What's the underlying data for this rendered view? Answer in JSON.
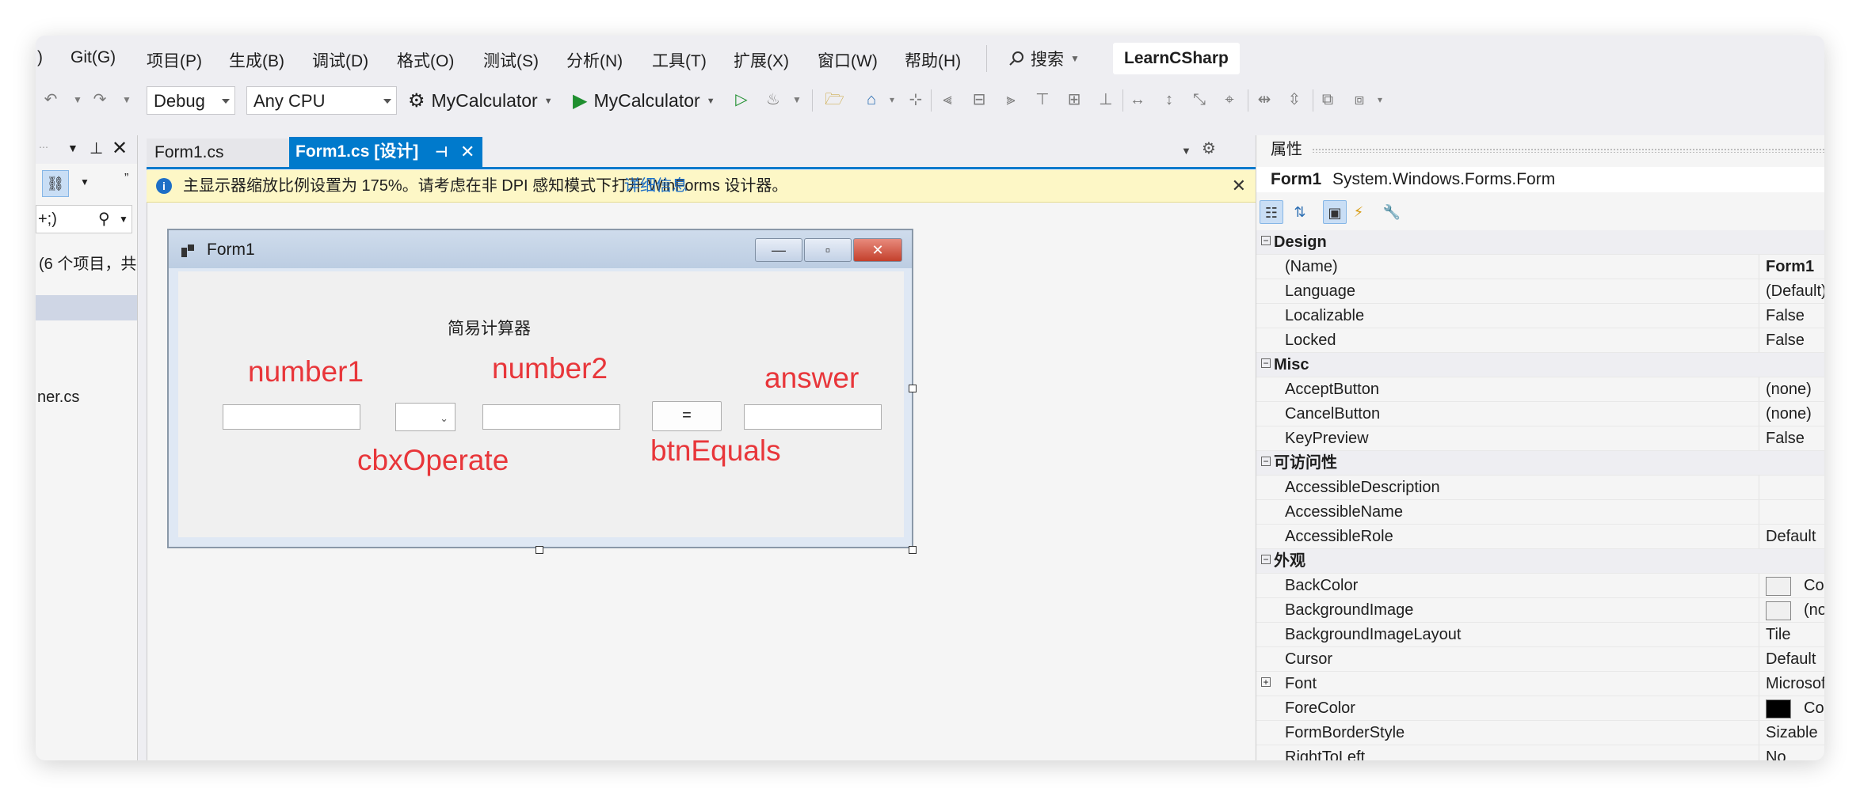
{
  "menu": {
    "items": [
      ")",
      "Git(G)",
      "项目(P)",
      "生成(B)",
      "调试(D)",
      "格式(O)",
      "测试(S)",
      "分析(N)",
      "工具(T)",
      "扩展(X)",
      "窗口(W)",
      "帮助(H)"
    ],
    "search_label": "搜索",
    "solution_name": "LearnCSharp"
  },
  "toolbar": {
    "config": "Debug",
    "platform": "Any CPU",
    "startup_project": "MyCalculator",
    "run_target": "MyCalculator"
  },
  "left_panel": {
    "search_text": "+;)",
    "summary_text": "(6 个项目，共",
    "file_fragment": "ner.cs"
  },
  "tabs": [
    {
      "label": "Form1.cs",
      "active": false
    },
    {
      "label": "Form1.cs [设计]",
      "active": true
    }
  ],
  "infobar": {
    "message": "主显示器缩放比例设置为 175%。请考虑在非 DPI 感知模式下打开 WinForms 设计器。",
    "link": "详细信息"
  },
  "form": {
    "title": "Form1",
    "heading": "简易计算器",
    "annotations": {
      "number1": "number1",
      "number2": "number2",
      "answer": "answer",
      "cbxOperate": "cbxOperate",
      "btnEquals": "btnEquals"
    },
    "equals_label": "=",
    "annotation_color": "#e8363a"
  },
  "properties": {
    "header": "属性",
    "object_name": "Form1",
    "object_type": "System.Windows.Forms.Form",
    "rows": [
      {
        "type": "cat",
        "name": "Design"
      },
      {
        "type": "prop",
        "name": "(Name)",
        "value": "Form1",
        "bold": true
      },
      {
        "type": "prop",
        "name": "Language",
        "value": "(Default)"
      },
      {
        "type": "prop",
        "name": "Localizable",
        "value": "False"
      },
      {
        "type": "prop",
        "name": "Locked",
        "value": "False"
      },
      {
        "type": "cat",
        "name": "Misc"
      },
      {
        "type": "prop",
        "name": "AcceptButton",
        "value": "(none)"
      },
      {
        "type": "prop",
        "name": "CancelButton",
        "value": "(none)"
      },
      {
        "type": "prop",
        "name": "KeyPreview",
        "value": "False"
      },
      {
        "type": "cat",
        "name": "可访问性"
      },
      {
        "type": "prop",
        "name": "AccessibleDescription",
        "value": ""
      },
      {
        "type": "prop",
        "name": "AccessibleName",
        "value": ""
      },
      {
        "type": "prop",
        "name": "AccessibleRole",
        "value": "Default"
      },
      {
        "type": "cat",
        "name": "外观"
      },
      {
        "type": "prop",
        "name": "BackColor",
        "value": "Control",
        "swatch": "#f0f0f0"
      },
      {
        "type": "prop",
        "name": "BackgroundImage",
        "value": "(none)",
        "swatch": "#f0f0f0"
      },
      {
        "type": "prop",
        "name": "BackgroundImageLayout",
        "value": "Tile"
      },
      {
        "type": "prop",
        "name": "Cursor",
        "value": "Default"
      },
      {
        "type": "prop",
        "name": "Font",
        "value": "Microsoft Ya",
        "expandable": true
      },
      {
        "type": "prop",
        "name": "ForeColor",
        "value": "ControlT",
        "swatch": "#000000"
      },
      {
        "type": "prop",
        "name": "FormBorderStyle",
        "value": "Sizable"
      },
      {
        "type": "prop",
        "name": "RightToLeft",
        "value": "No"
      }
    ]
  }
}
